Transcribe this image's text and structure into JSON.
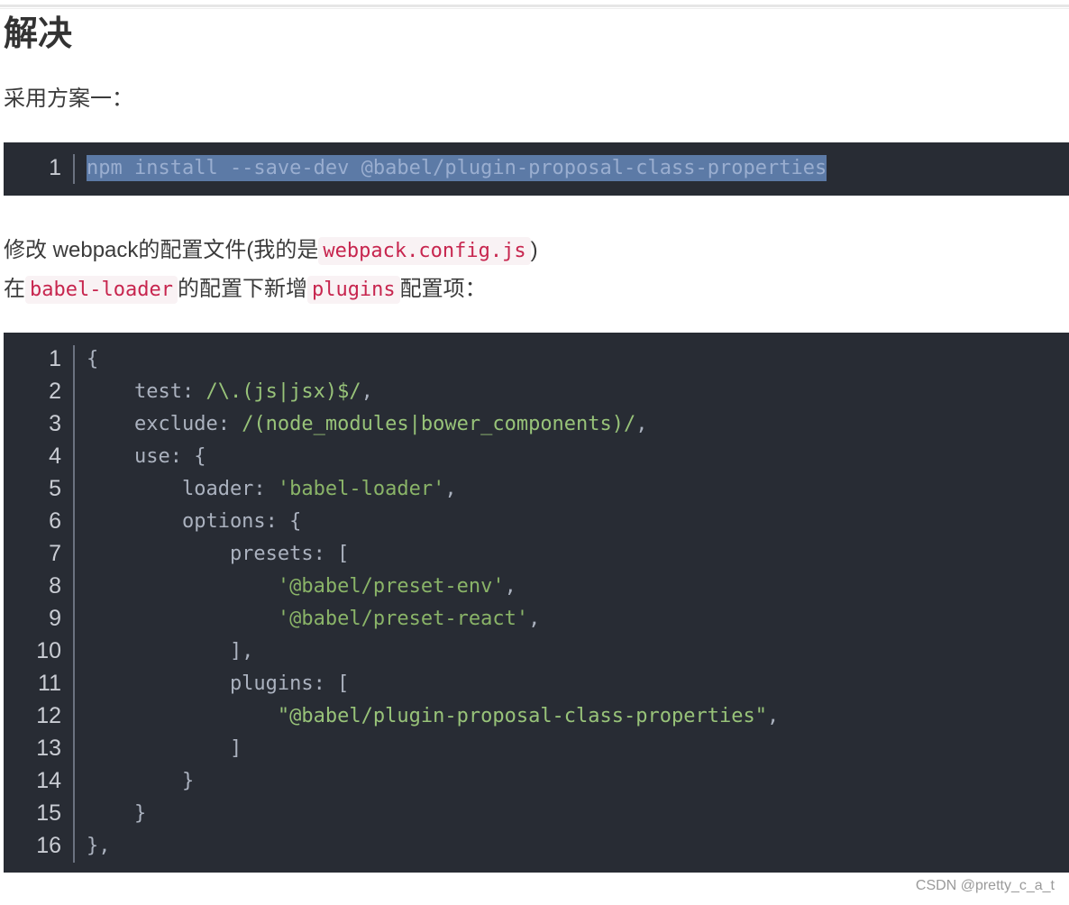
{
  "heading": "解决",
  "intro": "采用方案一：",
  "install_cmd": "npm install --save-dev @babel/plugin-proposal-class-properties",
  "p2": {
    "before": "修改 webpack的配置文件(我的是",
    "code": "webpack.config.js",
    "after": ")"
  },
  "p3": {
    "before": "在",
    "code1": "babel-loader",
    "middle": "的配置下新增",
    "code2": "plugins",
    "after": "配置项："
  },
  "code_block": {
    "lines": [
      "1",
      "2",
      "3",
      "4",
      "5",
      "6",
      "7",
      "8",
      "9",
      "10",
      "11",
      "12",
      "13",
      "14",
      "15",
      "16"
    ]
  },
  "footer": "CSDN @pretty_c_a_t"
}
